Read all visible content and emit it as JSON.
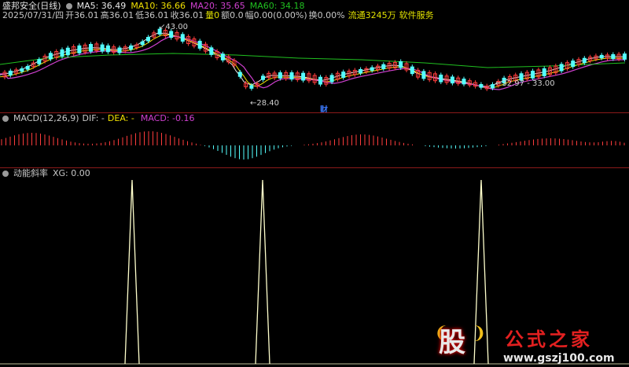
{
  "header": {
    "title": "盛邦安全(日线)",
    "ma5": "MA5: 36.49",
    "ma10": "MA10: 36.66",
    "ma20": "MA20: 35.65",
    "ma60": "MA60: 34.18",
    "date": "2025/07/31/四",
    "open": "开36.01",
    "high": "高36.01",
    "low": "低36.01",
    "close": "收36.01",
    "vol": "量0",
    "amount": "额0.0",
    "change": "幅0.00(0.00%)",
    "turnover": "换0.00%",
    "float": "流通3245万",
    "service": "软件服务"
  },
  "annotations": {
    "high_mark": "43.00",
    "low_mark": "28.40",
    "right_mark": "32.97 - 33.00",
    "fin_badge": "财"
  },
  "macd": {
    "label": "MACD(12,26,9)",
    "dif": "DIF: -",
    "dea": "DEA: -",
    "macd": "MACD: -0.16"
  },
  "indicator": {
    "label": "动能斜率",
    "xg": "XG: 0.00"
  },
  "watermark": {
    "logo": "股",
    "name": "公式之家",
    "url": "www.gszj100.com"
  },
  "colors": {
    "ma5": "#e8e8e8",
    "ma10": "#f0e000",
    "ma20": "#d040d0",
    "ma60": "#20c020",
    "up": "#ff3c3c",
    "down": "#54ffff",
    "separator": "#8b1a1a",
    "spike": "#ffffcc"
  },
  "chart_data": [
    {
      "type": "line",
      "title": "动能斜率",
      "series": [
        {
          "name": "XG",
          "x": [
            168,
            334,
            612
          ],
          "values": [
            1,
            1,
            1
          ]
        }
      ]
    }
  ]
}
